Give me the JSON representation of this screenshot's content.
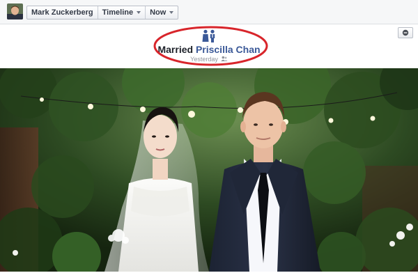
{
  "header": {
    "profile_name": "Mark Zuckerberg",
    "timeline_label": "Timeline",
    "period_label": "Now"
  },
  "event": {
    "verb": "Married",
    "partner": "Priscilla Chan",
    "time": "Yesterday",
    "icon": "wedding-couple-icon",
    "audience_icon": "friends-audience-icon",
    "collapse_icon": "minus-icon"
  },
  "annotation_color": "#d8252b",
  "colors": {
    "link": "#3b5998",
    "bar_bg": "#f6f7f8"
  }
}
